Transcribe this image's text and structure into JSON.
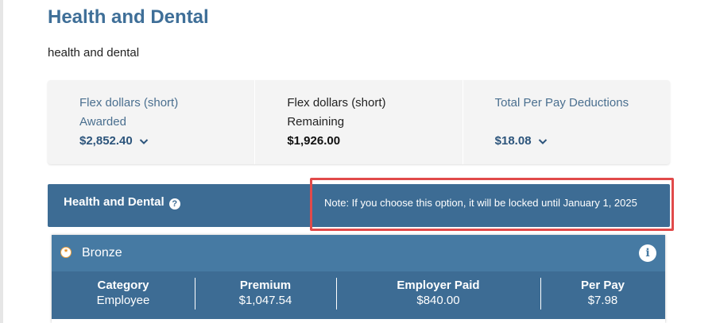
{
  "page": {
    "title": "Health and Dental",
    "subtitle": "health and dental"
  },
  "summary": [
    {
      "line1": "Flex dollars (short)",
      "line2": "Awarded",
      "amount": "$2,852.40",
      "expandable": true
    },
    {
      "line1": "Flex dollars (short)",
      "line2": "Remaining",
      "amount": "$1,926.00",
      "expandable": false
    },
    {
      "line1": "Total Per Pay Deductions",
      "line2": "",
      "amount": "$18.08",
      "expandable": true
    }
  ],
  "panel": {
    "title": "Health and Dental",
    "help_icon": "?",
    "note": "Note: If you choose this option, it will be locked until January 1, 2025"
  },
  "plan": {
    "name": "Bronze",
    "selected_icon": "*",
    "info_icon": "i",
    "columns": [
      {
        "header": "Category",
        "value": "Employee"
      },
      {
        "header": "Premium",
        "value": "$1,047.54"
      },
      {
        "header": "Employer Paid",
        "value": "$840.00"
      },
      {
        "header": "Per Pay",
        "value": "$7.98"
      }
    ]
  },
  "colors": {
    "title_blue": "#3f6f98",
    "panel_blue": "#3d6c94",
    "plan_header_blue": "#467aa3",
    "highlight_red": "#e14a4a"
  }
}
